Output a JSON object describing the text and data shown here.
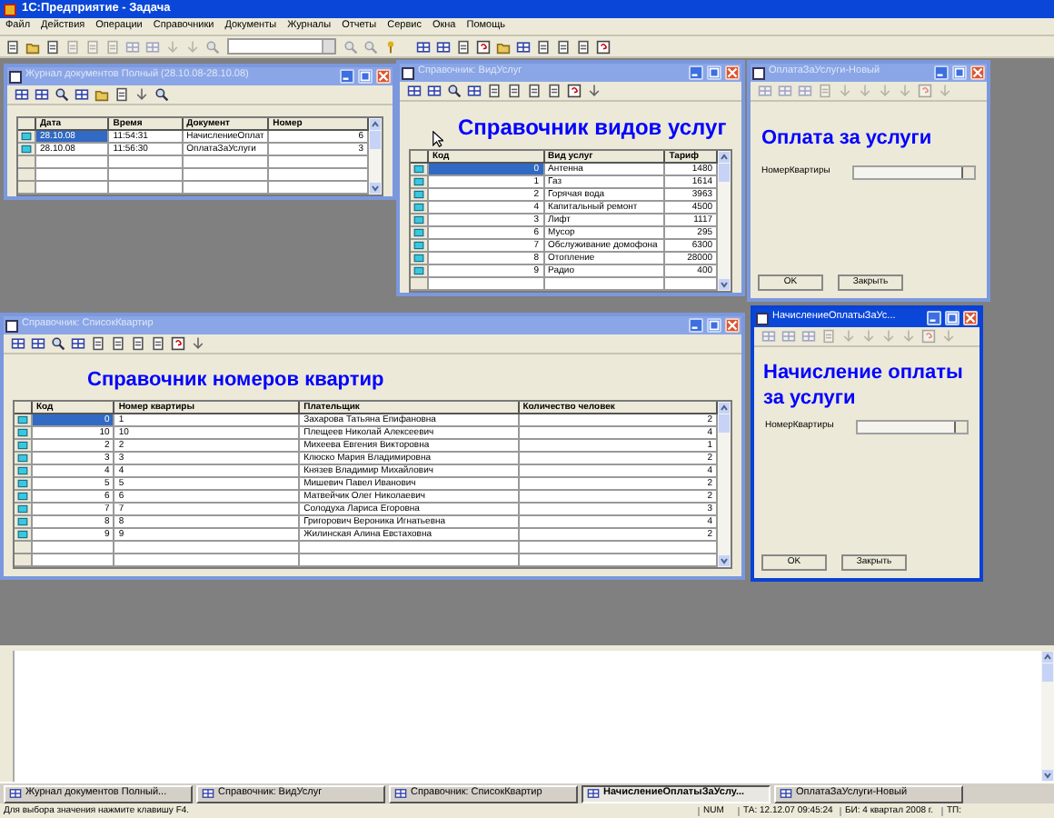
{
  "app_title": "1С:Предприятие - Задача",
  "menu": [
    "Файл",
    "Действия",
    "Операции",
    "Справочники",
    "Документы",
    "Журналы",
    "Отчеты",
    "Сервис",
    "Окна",
    "Помощь"
  ],
  "windows": [
    {
      "kind": "journal",
      "title": "Журнал документов Полный (28.10.08-28.10.08)",
      "active": false,
      "columns": [
        "Дата",
        "Время",
        "Документ",
        "Номер"
      ],
      "rows": [
        {
          "cells": [
            "28.10.08",
            "11:54:31",
            "НачислениеОплат",
            "6"
          ],
          "selected": true
        },
        {
          "cells": [
            "28.10.08",
            "11:56:30",
            "ОплатаЗаУслуги",
            "3"
          ],
          "selected": false
        }
      ]
    },
    {
      "kind": "catalog",
      "title": "Справочник: ВидУслуг",
      "active": false,
      "heading": "Справочник видов услуг",
      "columns": [
        "Код",
        "Вид услуг",
        "Тариф"
      ],
      "rows": [
        {
          "cells": [
            "0",
            "Антенна",
            "1480"
          ],
          "selected": true
        },
        {
          "cells": [
            "1",
            "Газ",
            "1614"
          ],
          "selected": false
        },
        {
          "cells": [
            "2",
            "Горячая вода",
            "3963"
          ],
          "selected": false
        },
        {
          "cells": [
            "4",
            "Капитальный ремонт",
            "4500"
          ],
          "selected": false
        },
        {
          "cells": [
            "3",
            "Лифт",
            "1117"
          ],
          "selected": false
        },
        {
          "cells": [
            "6",
            "Мусор",
            "295"
          ],
          "selected": false
        },
        {
          "cells": [
            "7",
            "Обслуживание домофона",
            "6300"
          ],
          "selected": false
        },
        {
          "cells": [
            "8",
            "Отопление",
            "28000"
          ],
          "selected": false
        },
        {
          "cells": [
            "9",
            "Радио",
            "400"
          ],
          "selected": false
        }
      ]
    },
    {
      "kind": "form",
      "title": "ОплатаЗаУслуги-Новый",
      "active": false,
      "heading": "Оплата за услуги",
      "field_label": "НомерКвартиры",
      "buttons": [
        "OK",
        "Закрыть"
      ]
    },
    {
      "kind": "catalog",
      "title": "Справочник: СписокКвартир",
      "active": false,
      "heading": "Справочник номеров квартир",
      "columns": [
        "Код",
        "Номер квартиры",
        "Плательщик",
        "Количество человек"
      ],
      "rows": [
        {
          "cells": [
            "0",
            "1",
            "Захарова Татьяна Епифановна",
            "2"
          ],
          "selected": true
        },
        {
          "cells": [
            "10",
            "10",
            "Плещеев Николай Алексеевич",
            "4"
          ],
          "selected": false
        },
        {
          "cells": [
            "2",
            "2",
            "Михеева Евгения Викторовна",
            "1"
          ],
          "selected": false
        },
        {
          "cells": [
            "3",
            "3",
            "Клюско Мария Владимировна",
            "2"
          ],
          "selected": false
        },
        {
          "cells": [
            "4",
            "4",
            "Князев Владимир Михайлович",
            "4"
          ],
          "selected": false
        },
        {
          "cells": [
            "5",
            "5",
            "Мишевич Павел Иванович",
            "2"
          ],
          "selected": false
        },
        {
          "cells": [
            "6",
            "6",
            "Матвейчик Олег Николаевич",
            "2"
          ],
          "selected": false
        },
        {
          "cells": [
            "7",
            "7",
            "Солодуха Лариса Егоровна",
            "3"
          ],
          "selected": false
        },
        {
          "cells": [
            "8",
            "8",
            "Григорович Вероника Игнатьевна",
            "4"
          ],
          "selected": false
        },
        {
          "cells": [
            "9",
            "9",
            "Жилинская Алина Евстаховна",
            "2"
          ],
          "selected": false
        }
      ]
    },
    {
      "kind": "form",
      "title": "НачислениеОплатыЗаУс...",
      "active": true,
      "heading": "Начисление оплаты за услуги",
      "field_label": "НомерКвартиры",
      "buttons": [
        "OK",
        "Закрыть"
      ]
    }
  ],
  "taskbar": [
    {
      "label": "Журнал документов Полный...",
      "selected": false
    },
    {
      "label": "Справочник: ВидУслуг",
      "selected": false
    },
    {
      "label": "Справочник: СписокКвартир",
      "selected": false
    },
    {
      "label": "НачислениеОплатыЗаУслу...",
      "selected": true
    },
    {
      "label": "ОплатаЗаУслуги-Новый",
      "selected": false
    }
  ],
  "status_bar": {
    "hint": "Для выбора значения нажмите клавишу F4.",
    "fields": [
      "NUM",
      "ТА: 12.12.07 09:45:24",
      "БИ: 4 квартал 2008 г.",
      "ТП:"
    ]
  }
}
